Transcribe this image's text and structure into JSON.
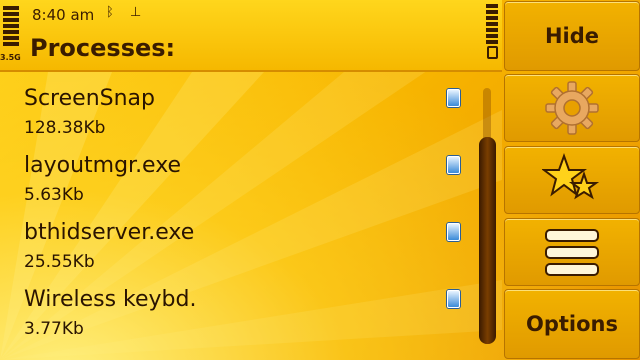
{
  "status_bar": {
    "time": "8:40 am",
    "network": "3.5G",
    "icons": [
      "bluetooth-icon",
      "usb-icon"
    ],
    "signal_level": 1.0,
    "battery_level": 1.0
  },
  "header": {
    "title": "Processes:"
  },
  "processes": [
    {
      "name": "ScreenSnap",
      "size": "128.38Kb"
    },
    {
      "name": "layoutmgr.exe",
      "size": "5.63Kb"
    },
    {
      "name": "bthidserver.exe",
      "size": "25.55Kb"
    },
    {
      "name": "Wireless keybd.",
      "size": "3.77Kb"
    }
  ],
  "toolbar": {
    "hide_label": "Hide",
    "settings_icon": "gear-icon",
    "favorites_icon": "stars-icon",
    "menu_icon": "menu-list-icon",
    "options_label": "Options"
  },
  "colors": {
    "accent": "#f6b800",
    "text": "#3a1c00",
    "scrollbar": "#4a2400"
  }
}
